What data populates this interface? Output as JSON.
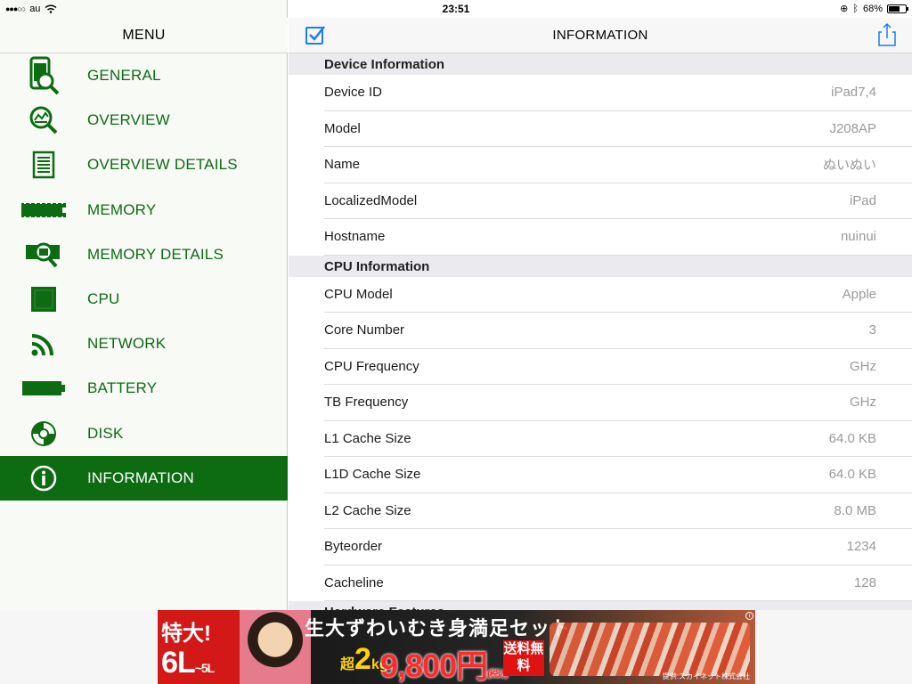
{
  "status_bar": {
    "carrier": "au",
    "time": "23:51",
    "battery": "68%",
    "battery_level": 0.68
  },
  "left_panel": {
    "title": "MENU",
    "items": [
      {
        "label": "GENERAL",
        "icon": "general-icon"
      },
      {
        "label": "OVERVIEW",
        "icon": "overview-icon"
      },
      {
        "label": "OVERVIEW DETAILS",
        "icon": "document-icon"
      },
      {
        "label": "MEMORY",
        "icon": "memory-chip-icon"
      },
      {
        "label": "MEMORY DETAILS",
        "icon": "memory-magnify-icon"
      },
      {
        "label": "CPU",
        "icon": "cpu-icon"
      },
      {
        "label": "NETWORK",
        "icon": "wifi-signal-icon"
      },
      {
        "label": "BATTERY",
        "icon": "battery-icon"
      },
      {
        "label": "DISK",
        "icon": "disk-icon"
      },
      {
        "label": "INFORMATION",
        "icon": "info-icon",
        "active": true
      }
    ]
  },
  "right_panel": {
    "title": "INFORMATION",
    "sections": [
      {
        "header": "Device Information",
        "rows": [
          {
            "label": "Device ID",
            "value": "iPad7,4"
          },
          {
            "label": "Model",
            "value": "J208AP"
          },
          {
            "label": "Name",
            "value": "ぬいぬい"
          },
          {
            "label": "LocalizedModel",
            "value": "iPad"
          },
          {
            "label": "Hostname",
            "value": "nuinui"
          }
        ]
      },
      {
        "header": "CPU Information",
        "rows": [
          {
            "label": "CPU Model",
            "value": "Apple"
          },
          {
            "label": "Core Number",
            "value": "3"
          },
          {
            "label": "CPU Frequency",
            "value": "GHz"
          },
          {
            "label": "TB Frequency",
            "value": "GHz"
          },
          {
            "label": "L1 Cache Size",
            "value": "64.0 KB"
          },
          {
            "label": "L1D Cache Size",
            "value": "64.0 KB"
          },
          {
            "label": "L2 Cache Size",
            "value": "8.0 MB"
          },
          {
            "label": "Byteorder",
            "value": "1234"
          },
          {
            "label": "Cacheline",
            "value": "128"
          }
        ]
      },
      {
        "header": "Hardware Features",
        "rows": []
      }
    ]
  },
  "ad": {
    "top_text": "特大!",
    "size_text": "6L",
    "size_suffix": "~5L",
    "headline": "生大ずわいむき身満足セット",
    "weight_prefix": "超",
    "weight": "2",
    "weight_unit": "kg",
    "price": "9,800円",
    "price_note": "(税込)",
    "shipping": "送料無料",
    "credit": "提供:スカイネット株式会社"
  },
  "colors": {
    "accent": "#0d6b12",
    "icon_blue": "#1e7cf2"
  }
}
